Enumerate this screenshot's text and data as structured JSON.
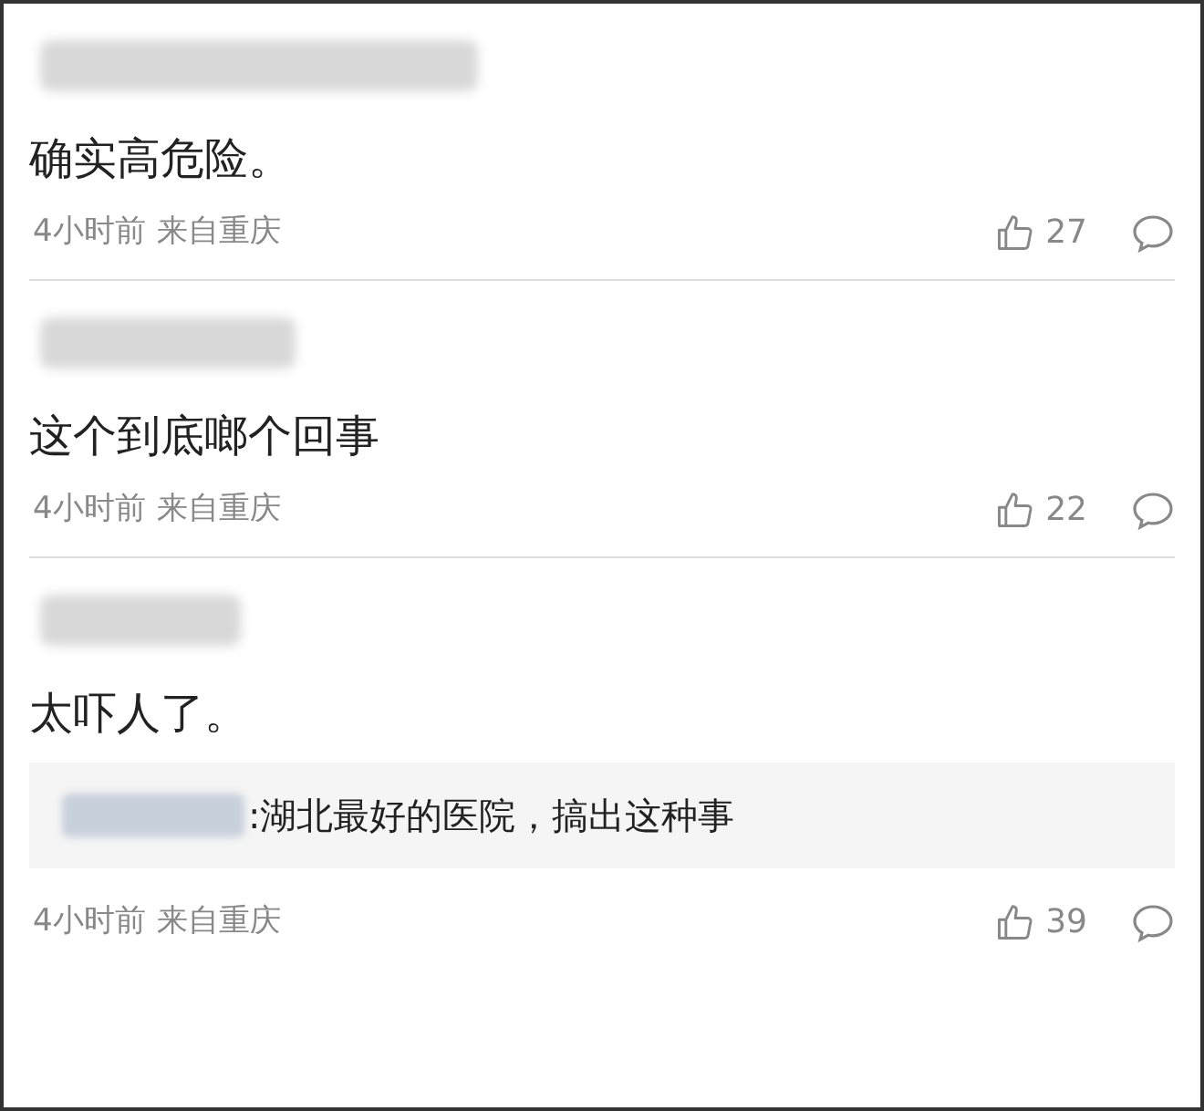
{
  "comments": [
    {
      "text": "确实高危险。",
      "time": "4小时前",
      "location": "来自重庆",
      "likes": "27"
    },
    {
      "text": "这个到底啷个回事",
      "time": "4小时前",
      "location": "来自重庆",
      "likes": "22"
    },
    {
      "text": "太吓人了。",
      "reply": {
        "text": ":湖北最好的医院，搞出这种事"
      },
      "time": "4小时前",
      "location": "来自重庆",
      "likes": "39"
    }
  ]
}
